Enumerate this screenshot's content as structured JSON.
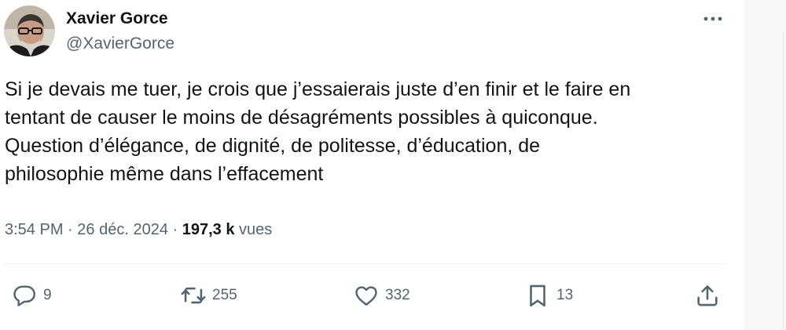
{
  "author": {
    "display_name": "Xavier Gorce",
    "handle": "@XavierGorce"
  },
  "tweet": {
    "text": "Si je devais me tuer, je crois que j’essaierais juste d’en finir et le faire en\ntentant de causer le moins de désagréments possibles à quiconque.\nQuestion d’élégance, de dignité, de politesse, d’éducation, de\nphilosophie même dans l’effacement",
    "time": "3:54 PM",
    "dot1": "·",
    "date": "26 déc. 2024",
    "dot2": "·",
    "views_count": "197,3 k",
    "views_label": "vues"
  },
  "actions": {
    "replies": "9",
    "retweets": "255",
    "likes": "332",
    "bookmarks": "13"
  },
  "icons": {
    "more": "more-horizontal-icon",
    "reply": "reply-icon",
    "retweet": "retweet-icon",
    "like": "heart-icon",
    "bookmark": "bookmark-icon",
    "share": "share-icon"
  },
  "colors": {
    "text_primary": "#0f1419",
    "text_secondary": "#536471",
    "divider": "#eff3f4"
  }
}
